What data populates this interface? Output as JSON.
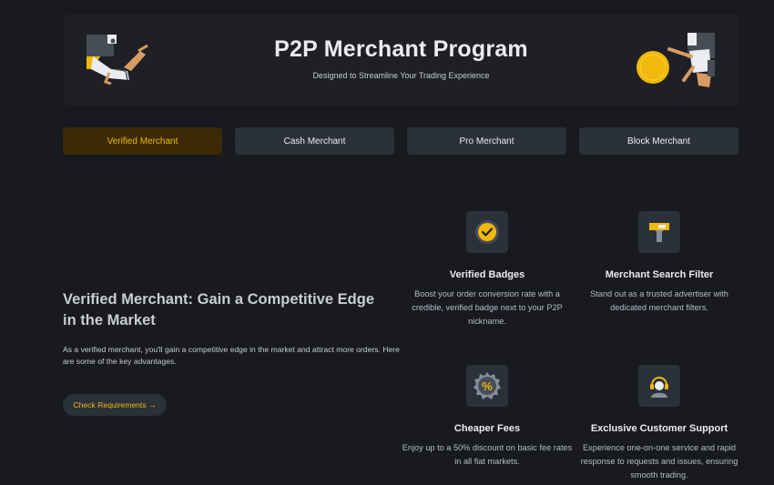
{
  "hero": {
    "title": "P2P Merchant Program",
    "subtitle": "Designed to Streamline Your Trading Experience"
  },
  "tabs": [
    {
      "label": "Verified Merchant",
      "active": true
    },
    {
      "label": "Cash Merchant",
      "active": false
    },
    {
      "label": "Pro Merchant",
      "active": false
    },
    {
      "label": "Block Merchant",
      "active": false
    }
  ],
  "intro": {
    "title": "Verified Merchant: Gain a Competitive Edge in the Market",
    "text": "As a verified merchant, you'll gain a competitive edge in the market and attract more orders. Here are some of the key advantages.",
    "cta_label": "Check Requirements →"
  },
  "features": [
    {
      "icon": "verified-badge-icon",
      "title": "Verified Badges",
      "desc": "Boost your order conversion rate with a credible, verified badge next to your P2P nickname."
    },
    {
      "icon": "search-filter-icon",
      "title": "Merchant Search Filter",
      "desc": "Stand out as a trusted advertiser with dedicated merchant filters."
    },
    {
      "icon": "discount-icon",
      "title": "Cheaper Fees",
      "desc": "Enjoy up to a 50% discount on basic fee rates in all fiat markets."
    },
    {
      "icon": "support-agent-icon",
      "title": "Exclusive Customer Support",
      "desc": "Experience one-on-one service and rapid response to requests and issues, ensuring smooth trading."
    }
  ],
  "colors": {
    "background": "#181a20",
    "panel": "#1e2026",
    "tab": "#2b3139",
    "accent": "#f0b90b",
    "active_tab_bg": "#3c2a05"
  }
}
